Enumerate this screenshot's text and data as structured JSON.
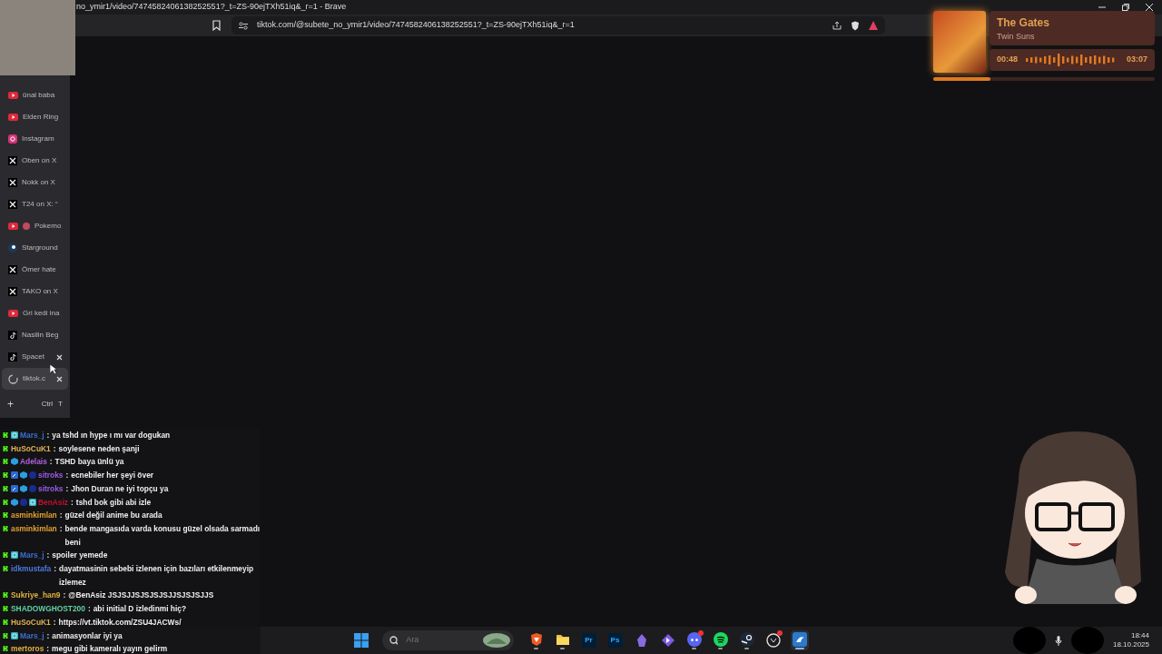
{
  "window": {
    "title": "no_ymir1/video/7474582406138252551?_t=ZS-90ejTXh51iq&_r=1 - Brave"
  },
  "toolbar": {
    "url": "tiktok.com/@subete_no_ymir1/video/7474582406138252551?_t=ZS-90ejTXh51iq&_r=1"
  },
  "sidebar": {
    "tabs": [
      {
        "label": "ünal baba",
        "kind": "youtube",
        "selected": false,
        "closable": false,
        "indicator": false
      },
      {
        "label": "Elden Ring",
        "kind": "youtube",
        "selected": false,
        "closable": false,
        "indicator": false
      },
      {
        "label": "Instagram",
        "kind": "instagram",
        "selected": false,
        "closable": false,
        "indicator": false
      },
      {
        "label": "Oben on X",
        "kind": "x",
        "selected": false,
        "closable": false,
        "indicator": false
      },
      {
        "label": "Nokk on X",
        "kind": "x",
        "selected": false,
        "closable": false,
        "indicator": false
      },
      {
        "label": "T24 on X: “",
        "kind": "x",
        "selected": false,
        "closable": false,
        "indicator": false
      },
      {
        "label": "Pokemo",
        "kind": "youtube",
        "selected": false,
        "closable": false,
        "indicator": true
      },
      {
        "label": "Starground",
        "kind": "steam",
        "selected": false,
        "closable": false,
        "indicator": false
      },
      {
        "label": "Ömer hate",
        "kind": "x",
        "selected": false,
        "closable": false,
        "indicator": false
      },
      {
        "label": "TAKO on X",
        "kind": "x",
        "selected": false,
        "closable": false,
        "indicator": false
      },
      {
        "label": "Gri kedi ina",
        "kind": "youtube",
        "selected": false,
        "closable": false,
        "indicator": false
      },
      {
        "label": "Nasilin Beg",
        "kind": "tiktok",
        "selected": false,
        "closable": false,
        "indicator": false
      },
      {
        "label": "Spacet",
        "kind": "tiktok",
        "selected": false,
        "closable": true,
        "indicator": false
      },
      {
        "label": "tiktok.c",
        "kind": "loading",
        "selected": true,
        "closable": true,
        "indicator": false
      }
    ],
    "new_tab": {
      "symbol": "+",
      "keys": [
        "Ctrl",
        "T"
      ]
    }
  },
  "now_playing": {
    "title": "The Gates",
    "artist": "Twin Suns",
    "elapsed": "00:48",
    "duration": "03:07",
    "level": 0.26
  },
  "chat": {
    "messages": [
      {
        "user": "Mars_j",
        "color": "#3a6fd0",
        "badges": [
          {
            "kind": "kick"
          },
          {
            "kind": "sub"
          }
        ],
        "separator": ":",
        "text": "ya tshd ın hype ı mı var dogukan"
      },
      {
        "user": "HuSoCuK1",
        "color": "#e0b050",
        "badges": [
          {
            "kind": "kick"
          }
        ],
        "separator": ":",
        "text": "soylesene neden şanji"
      },
      {
        "user": "Adelais",
        "color": "#b060e0",
        "badges": [
          {
            "kind": "kick"
          },
          {
            "kind": "cube"
          }
        ],
        "separator": ":",
        "text": "TSHD baya ünlü ya"
      },
      {
        "user": "sitroks",
        "color": "#9a5ae6",
        "badges": [
          {
            "kind": "kick"
          },
          {
            "kind": "mod"
          },
          {
            "kind": "cube"
          },
          {
            "kind": "dot"
          }
        ],
        "separator": ":",
        "text": "ecnebiler her şeyi över"
      },
      {
        "user": "sitroks",
        "color": "#9a5ae6",
        "badges": [
          {
            "kind": "kick"
          },
          {
            "kind": "mod"
          },
          {
            "kind": "cube"
          },
          {
            "kind": "dot"
          }
        ],
        "separator": ":",
        "text": "Jhon Duran ne iyi topçu ya"
      },
      {
        "user": "BenAsiz",
        "color": "#c01030",
        "badges": [
          {
            "kind": "kick"
          },
          {
            "kind": "cube"
          },
          {
            "kind": "dot"
          },
          {
            "kind": "sub"
          }
        ],
        "separator": ":",
        "text": "tshd bok gibi abi izle"
      },
      {
        "user": "asminkimlan",
        "color": "#e0a030",
        "badges": [
          {
            "kind": "kick"
          }
        ],
        "separator": ":",
        "text": "güzel değil anime bu arada"
      },
      {
        "user": "asminkimlan",
        "color": "#e0a030",
        "badges": [
          {
            "kind": "kick"
          }
        ],
        "separator": ":",
        "text": "bende mangasıda varda konusu güzel olsada sarmadı beni"
      },
      {
        "user": "Mars_j",
        "color": "#3a6fd0",
        "badges": [
          {
            "kind": "kick"
          },
          {
            "kind": "sub"
          }
        ],
        "separator": ":",
        "text": "spoiler yemede"
      },
      {
        "user": "idkmustafa",
        "color": "#4a7ae0",
        "badges": [
          {
            "kind": "kick"
          }
        ],
        "separator": ":",
        "text": "dayatmasinin sebebi izlenen için bazıları etkilenmeyip izlemez"
      },
      {
        "user": "Sukriye_han9",
        "color": "#e0b040",
        "badges": [
          {
            "kind": "kick"
          }
        ],
        "separator": ":",
        "text": "@BenAsiz JSJSJJSJSJSJSJJSJSJSJJS"
      },
      {
        "user": "SHADOWGHOST200",
        "color": "#60d0a0",
        "badges": [
          {
            "kind": "kick"
          }
        ],
        "separator": ":",
        "text": "abi initial D izledinmi hiç?"
      },
      {
        "user": "HuSoCuK1",
        "color": "#e0b050",
        "badges": [
          {
            "kind": "kick"
          }
        ],
        "separator": ":",
        "text": "https://vt.tiktok.com/ZSU4JACWs/"
      },
      {
        "user": "Mars_j",
        "color": "#3a6fd0",
        "badges": [
          {
            "kind": "kick"
          },
          {
            "kind": "sub"
          }
        ],
        "separator": ":",
        "text": "animasyonlar iyi ya"
      },
      {
        "user": "mertoros",
        "color": "#e0b040",
        "badges": [
          {
            "kind": "kick"
          }
        ],
        "separator": ":",
        "text": "megu gibi kameralı yayın gelirm"
      }
    ]
  },
  "taskbar": {
    "search": {
      "placeholder": "Ara"
    },
    "apps": [
      {
        "kind": "brave",
        "running": true,
        "selected": false,
        "notification": false
      },
      {
        "kind": "folder",
        "running": true,
        "selected": false,
        "notification": false
      },
      {
        "kind": "letters",
        "label": "Pr",
        "running": false,
        "selected": false,
        "notification": false
      },
      {
        "kind": "letters",
        "label": "Ps",
        "running": false,
        "selected": false,
        "notification": false
      },
      {
        "kind": "crystal",
        "running": false,
        "selected": false,
        "notification": false
      },
      {
        "kind": "arrow",
        "running": false,
        "selected": false,
        "notification": false
      },
      {
        "kind": "discord",
        "running": true,
        "selected": false,
        "notification": true
      },
      {
        "kind": "spotify",
        "running": true,
        "selected": false,
        "notification": false
      },
      {
        "kind": "steam",
        "running": true,
        "selected": false,
        "notification": false
      },
      {
        "kind": "circle",
        "running": false,
        "selected": false,
        "notification": true
      },
      {
        "kind": "bird",
        "running": true,
        "selected": true,
        "notification": false
      }
    ],
    "clock": {
      "time": "18:44",
      "date": "18.10.2025"
    }
  }
}
